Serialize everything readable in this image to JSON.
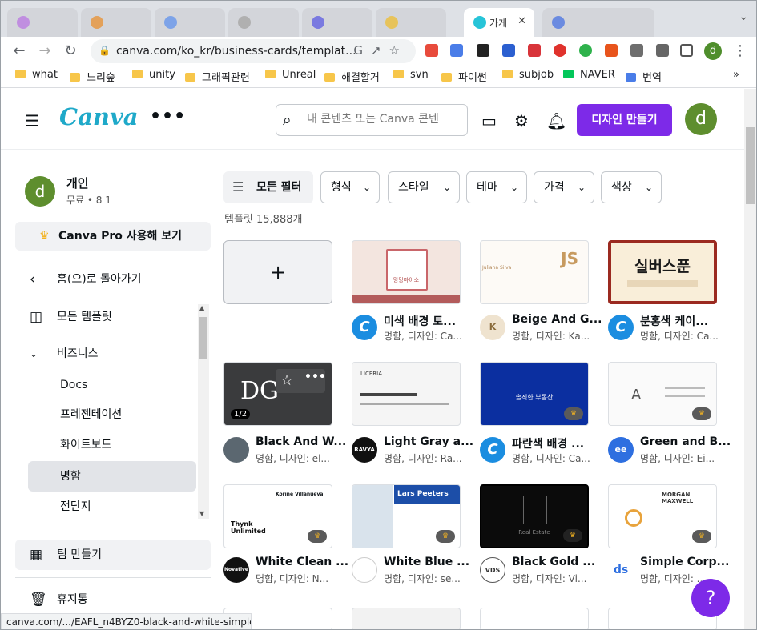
{
  "browser": {
    "active_tab_title": "가게",
    "url": "canva.com/ko_kr/business-cards/templat...",
    "bookmarks": [
      "what",
      "느리숲",
      "unity",
      "그래픽관련",
      "Unreal",
      "해결할거",
      "svn",
      "파이썬",
      "subjob",
      "NAVER",
      "번역"
    ],
    "profile_initial": "d",
    "status_url": "canva.com/.../EAFL_n4BYZ0-black-and-white-simple-p..."
  },
  "header": {
    "logo": "Canva",
    "search_placeholder": "내 콘텐츠 또는 Canva 콘텐",
    "create_label": "디자인 만들기",
    "avatar_initial": "d"
  },
  "sidebar": {
    "user_name": "개인",
    "user_sub": "무료 • 8 1",
    "avatar_initial": "d",
    "pro_label": "Canva Pro 사용해 보기",
    "back_label": "홈(으)로 돌아가기",
    "all_templates": "모든 템플릿",
    "business": "비즈니스",
    "items": [
      "Docs",
      "프레젠테이션",
      "화이트보드",
      "명함",
      "전단지"
    ],
    "team_label": "팀 만들기",
    "trash_label": "휴지통"
  },
  "filters": [
    "모든 필터",
    "형식",
    "스타일",
    "테마",
    "가격",
    "색상"
  ],
  "template_count": "템플릿 15,888개",
  "cards": [
    {
      "title": "미색 배경 토...",
      "sub": "명함, 디자인: Ca...",
      "avatar": "C",
      "avatar_color": "#1b8de0",
      "thumb_text": "망망마이소"
    },
    {
      "title": "Beige And G...",
      "sub": "명함, 디자인: Ka...",
      "avatar": "K",
      "avatar_color": "#e9dcc3",
      "thumb_text": "JS"
    },
    {
      "title": "분홍색 케이...",
      "sub": "명함, 디자인: Ca...",
      "avatar": "C",
      "avatar_color": "#1b8de0",
      "thumb_text": "실버스푼"
    },
    {
      "title": "Black And W...",
      "sub": "명함, 디자인: el...",
      "avatar": "",
      "avatar_color": "#5b6770",
      "thumb_text": "DG",
      "page": "1/2"
    },
    {
      "title": "Light Gray a...",
      "sub": "명함, 디자인: Ra...",
      "avatar": "RAVYA",
      "avatar_color": "#111111",
      "thumb_text": "LICERIA"
    },
    {
      "title": "파란색 배경 ...",
      "sub": "명함, 디자인: Ca...",
      "avatar": "C",
      "avatar_color": "#1b8de0",
      "thumb_text": "솔직한 부동산"
    },
    {
      "title": "Green and B...",
      "sub": "명함, 디자인: Ei...",
      "avatar": "ee",
      "avatar_color": "#2e6fe0",
      "thumb_text": "A"
    },
    {
      "title": "White Clean ...",
      "sub": "명함, 디자인: N...",
      "avatar": "Novative",
      "avatar_color": "#111111",
      "thumb_text": "Thynk Unlimited"
    },
    {
      "title": "White Blue ...",
      "sub": "명함, 디자인: se...",
      "avatar": "",
      "avatar_color": "#ffffff",
      "thumb_text": "Lars Peeters"
    },
    {
      "title": "Black Gold ...",
      "sub": "명함, 디자인: Vi...",
      "avatar": "VDS",
      "avatar_color": "#ffffff",
      "thumb_text": "Real Estate"
    },
    {
      "title": "Simple Corp...",
      "sub": "명함, 디자인: ...",
      "avatar": "ds",
      "avatar_color": "#ffffff",
      "thumb_text": "MORGAN MAXWELL"
    }
  ],
  "help_label": "?"
}
